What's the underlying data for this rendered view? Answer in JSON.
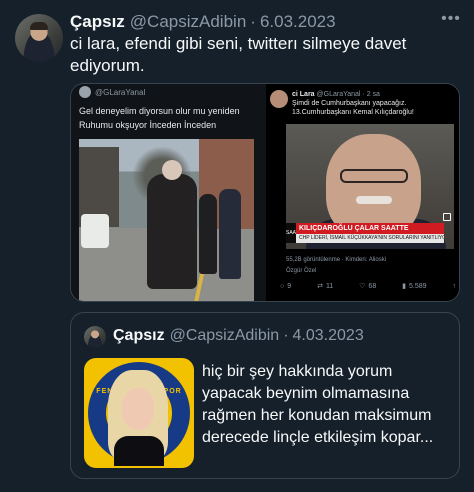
{
  "tweet": {
    "author_name": "Çapsız",
    "author_handle": "@CapsizAdibin",
    "separator": "·",
    "date": "6.03.2023",
    "more_icon": "more-horizontal-icon",
    "text": "ci lara, efendi gibi seni, twitterı silmeye davet ediyorum."
  },
  "media_left": {
    "handle": "@GLaraYanal",
    "caption": "Gel deneyelim diyorsun olur mu yeniden Ruhumu okşuyor İnceden İnceden"
  },
  "media_right": {
    "name": "ci Lara",
    "handle": "@GLaraYanal",
    "time": "· 2 sa",
    "line1": "Şimdi de Cumhurbaşkanı yapacağız.",
    "line2": "13.Cumhurbaşkanı Kemal Kılıçdaroğlu!",
    "banner_title": "KILIÇDAROĞLU ÇALAR SAATTE",
    "banner_sub": "CHP LİDERİ, İSMAİL KÜÇÜKKAYA'NIN SORULARINI YANITLIYOR",
    "banner_left": "SAAT",
    "views": "55,2B görüntülenme · Kimden: Alioski",
    "owner": "Özgür Özel",
    "actions": {
      "replies": "9",
      "retweets": "11",
      "likes": "68",
      "views": "5.589"
    }
  },
  "quote": {
    "author_name": "Çapsız",
    "author_handle": "@CapsizAdibin",
    "separator": "·",
    "date": "4.03.2023",
    "image_text": "FENERBAHÇE SPOR KULÜBÜ",
    "text": "hiç bir şey hakkında yorum yapacak beynim olmamasına rağmen her konudan maksimum derecede linçle etkileşim kopar..."
  },
  "colors": {
    "background": "#15202b",
    "text": "#f7f9f9",
    "secondary": "#8b98a5",
    "border": "#38444d"
  }
}
